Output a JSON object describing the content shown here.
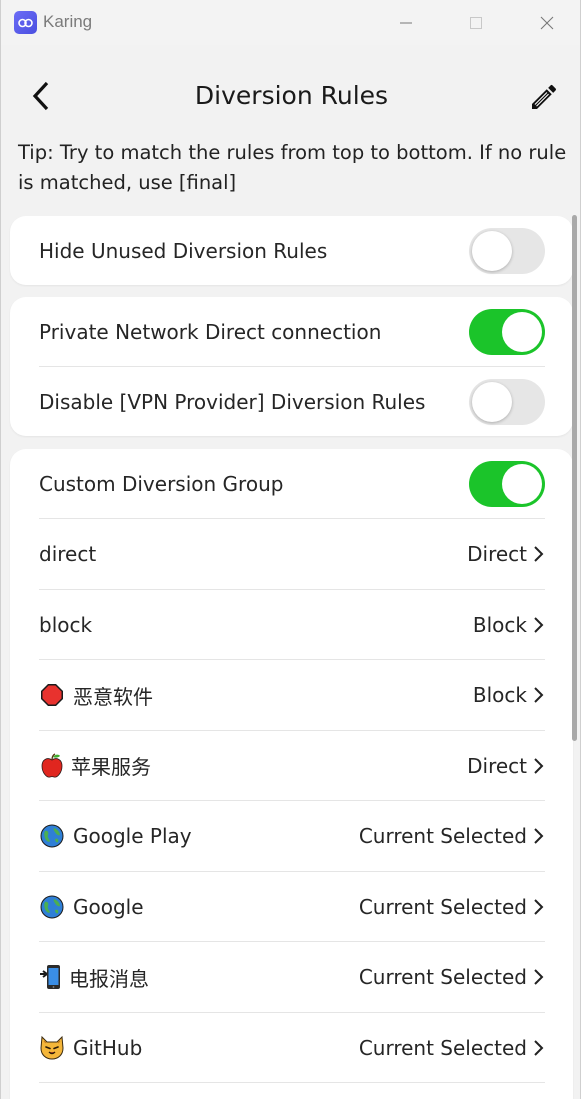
{
  "window": {
    "title": "Karing"
  },
  "header": {
    "title": "Diversion Rules",
    "tip": "Tip: Try to match the rules from top to bottom. If no rule is matched, use [final]"
  },
  "settings": {
    "hide_unused": {
      "label": "Hide Unused Diversion Rules",
      "enabled": false
    },
    "private_direct": {
      "label": "Private Network Direct connection",
      "enabled": true
    },
    "disable_vpn_provider": {
      "label": "Disable [VPN Provider] Diversion Rules",
      "enabled": false
    },
    "custom_group": {
      "label": "Custom Diversion Group",
      "enabled": true
    }
  },
  "rules": [
    {
      "icon": "none",
      "name": "direct",
      "value": "Direct"
    },
    {
      "icon": "stop-sign-icon",
      "name": "恶意软件",
      "value": "Block"
    },
    {
      "icon": "none",
      "name": "block",
      "value": "Block"
    },
    {
      "icon": "apple-icon",
      "name": "苹果服务",
      "value": "Direct"
    },
    {
      "icon": "globe-icon",
      "name": "Google Play",
      "value": "Current Selected"
    },
    {
      "icon": "globe-icon",
      "name": "Google",
      "value": "Current Selected"
    },
    {
      "icon": "mobile-phone-icon",
      "name": "电报消息",
      "value": "Current Selected"
    },
    {
      "icon": "cat-icon",
      "name": "GitHub",
      "value": "Current Selected"
    }
  ],
  "colors": {
    "toggle_on": "#1bc42a",
    "toggle_off": "#e6e6e6",
    "brand": "#5b5cf0"
  }
}
